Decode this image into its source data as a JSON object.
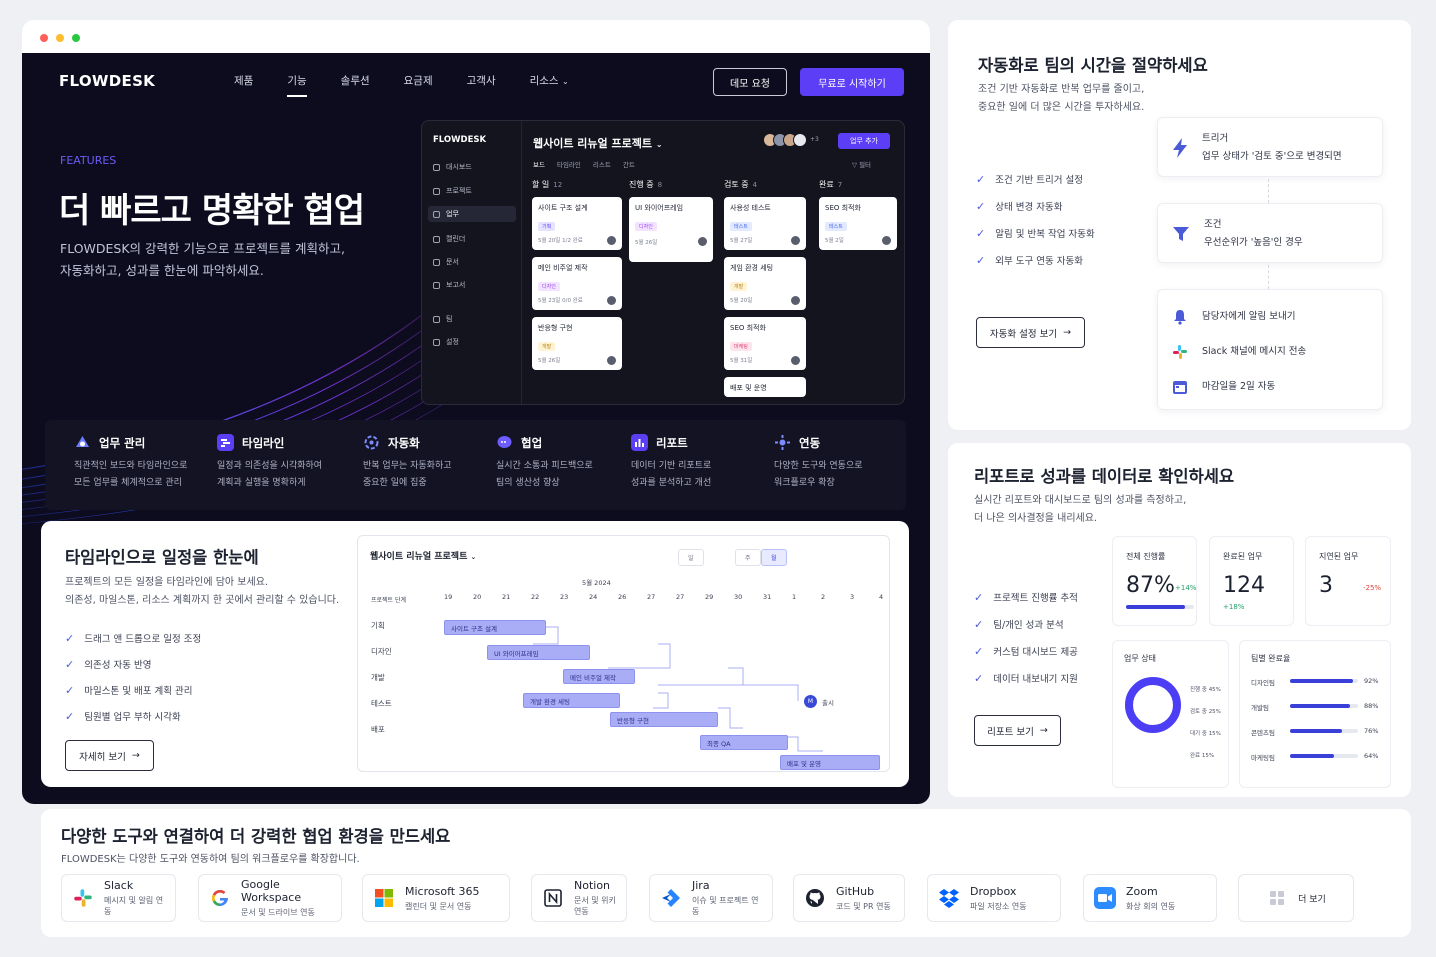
{
  "nav": {
    "logo": "FLOWDESK",
    "links": [
      "제품",
      "기능",
      "솔루션",
      "요금제",
      "고객사",
      "리소스"
    ],
    "demo": "데모 요청",
    "start": "무료로 시작하기"
  },
  "hero": {
    "eyebrow": "FEATURES",
    "title": "더 빠르고 명확한 협업",
    "subtitle_1": "FLOWDESK의 강력한 기능으로 프로젝트를 계획하고,",
    "subtitle_2": "자동화하고, 성과를 한눈에 파악하세요."
  },
  "app": {
    "logo": "FLOWDESK",
    "sidebar": [
      "대시보드",
      "프로젝트",
      "업무",
      "캘린더",
      "문서",
      "보고서",
      "팀",
      "설정"
    ],
    "project": "웹사이트 리뉴얼 프로젝트",
    "tabs": [
      "보드",
      "타임라인",
      "리스트",
      "간트"
    ],
    "members_more": "+3",
    "add": "업무 추가",
    "filter": "필터",
    "columns": [
      {
        "name": "할 일",
        "count": "12",
        "cards": [
          {
            "title": "사이트 구조 설계",
            "tag": "기획",
            "date": "5월 20일  1/2 완료"
          },
          {
            "title": "메인 비주얼 제작",
            "tag": "디자인",
            "date": "5월 23일  0/0 완료"
          },
          {
            "title": "반응형 구현",
            "tag": "개발",
            "date": "5월 26일"
          }
        ]
      },
      {
        "name": "진행 중",
        "count": "8",
        "cards": [
          {
            "title": "UI 와이어프레임",
            "tag": "디자인",
            "date": "5월 26일"
          }
        ]
      },
      {
        "name": "검토 중",
        "count": "4",
        "cards": [
          {
            "title": "사용성 테스트",
            "tag": "테스트",
            "date": "5월 27일"
          },
          {
            "title": "게임 환경 세팅",
            "tag": "개발",
            "date": "5월 20일"
          },
          {
            "title": "SEO 최적화",
            "tag": "마케팅",
            "date": "5월 31일"
          },
          {
            "title": "배포 및 운영",
            "tag": "",
            "date": ""
          }
        ]
      },
      {
        "name": "완료",
        "count": "7",
        "cards": [
          {
            "title": "SEO 최적화",
            "tag": "테스트",
            "date": "5월 2일"
          }
        ]
      }
    ]
  },
  "features": [
    {
      "title": "업무 관리",
      "l1": "직관적인 보드와 타임라인으로",
      "l2": "모든 업무를 체계적으로 관리",
      "icon": "task-icon"
    },
    {
      "title": "타임라인",
      "l1": "일정과 의존성을 시각화하여",
      "l2": "계획과 실행을 명확하게",
      "icon": "timeline-icon"
    },
    {
      "title": "자동화",
      "l1": "반복 업무는 자동화하고",
      "l2": "중요한 일에 집중",
      "icon": "automation-icon"
    },
    {
      "title": "협업",
      "l1": "실시간 소통과 피드백으로",
      "l2": "팀의 생산성 향상",
      "icon": "chat-icon"
    },
    {
      "title": "리포트",
      "l1": "데이터 기반 리포트로",
      "l2": "성과를 분석하고 개선",
      "icon": "report-icon"
    },
    {
      "title": "연동",
      "l1": "다양한 도구와 연동으로",
      "l2": "워크플로우 확장",
      "icon": "integration-icon"
    }
  ],
  "timeline": {
    "title": "타임라인으로 일정을 한눈에",
    "desc_1": "프로젝트의 모든 일정을 타임라인에 담아 보세요.",
    "desc_2": "의존성, 마일스톤, 리소스 계획까지 한 곳에서 관리할 수 있습니다.",
    "checks": [
      "드래그 앤 드롭으로 일정 조정",
      "의존성 자동 반영",
      "마일스톤 및 배포 계획 관리",
      "팀원별 업무 부하 시각화"
    ],
    "button": "자세히 보기",
    "gantt": {
      "title": "웹사이트 리뉴얼 프로젝트",
      "views": [
        "일",
        "주",
        "월"
      ],
      "month": "5월 2024",
      "days": [
        "19",
        "20",
        "21",
        "22",
        "23",
        "24",
        "26",
        "27",
        "27",
        "29",
        "30",
        "31",
        "1",
        "2",
        "3",
        "4"
      ],
      "stage_label": "프로젝트 단계",
      "rows": [
        "기획",
        "디자인",
        "개발",
        "테스트",
        "배포"
      ],
      "bars": [
        "사이트 구조 설계",
        "UI 와이어프레임",
        "메인 비주얼 제작",
        "개발 환경 세팅",
        "반응형 구현",
        "최종 QA",
        "배포 및 운영"
      ],
      "milestone": "M",
      "milestone_label": "출시"
    }
  },
  "automation": {
    "title": "자동화로 팀의 시간을 절약하세요",
    "desc_1": "조건 기반 자동화로 반복 업무를 줄이고,",
    "desc_2": "중요한 일에 더 많은 시간을 투자하세요.",
    "checks": [
      "조건 기반 트리거 설정",
      "상태 변경 자동화",
      "알림 및 반복 작업 자동화",
      "외부 도구 연동 자동화"
    ],
    "button": "자동화 설정 보기",
    "trigger_label": "트리거",
    "trigger_text": "업무 상태가 '검토 중'으로 변경되면",
    "condition_label": "조건",
    "condition_text": "우선순위가 '높음'인 경우",
    "actions": [
      "담당자에게 알림 보내기",
      "Slack 채널에 메시지 전송",
      "마감일을 2일 자동"
    ]
  },
  "reports": {
    "title": "리포트로 성과를 데이터로 확인하세요",
    "desc_1": "실시간 리포트와 대시보드로 팀의 성과를 측정하고,",
    "desc_2": "더 나은 의사결정을 내리세요.",
    "checks": [
      "프로젝트 진행률 추적",
      "팀/개인 성과 분석",
      "커스텀 대시보드 제공",
      "데이터 내보내기 지원"
    ],
    "button": "리포트 보기",
    "kpis": [
      {
        "label": "전체 진행률",
        "value": "87%",
        "delta": "+14%",
        "progress": 0.87
      },
      {
        "label": "완료된 업무",
        "value": "124",
        "delta": "+18%"
      },
      {
        "label": "지연된 업무",
        "value": "3",
        "delta": "-25%"
      }
    ],
    "status_title": "업무 상태",
    "status": [
      {
        "label": "진행 중",
        "pct": "45%"
      },
      {
        "label": "검토 중",
        "pct": "25%"
      },
      {
        "label": "대기 중",
        "pct": "15%"
      },
      {
        "label": "완료",
        "pct": "15%"
      }
    ],
    "team_title": "팀별 완료율",
    "teams": [
      {
        "label": "디자인팀",
        "pct": "92%",
        "value": 0.92
      },
      {
        "label": "개발팀",
        "pct": "88%",
        "value": 0.88
      },
      {
        "label": "콘텐츠팀",
        "pct": "76%",
        "value": 0.76
      },
      {
        "label": "마케팅팀",
        "pct": "64%",
        "value": 0.64
      }
    ]
  },
  "integrations": {
    "title": "다양한 도구와 연결하여 더 강력한 협업 환경을 만드세요",
    "desc": "FLOWDESK는 다양한 도구와 연동하여 팀의 워크플로우를 확장합니다.",
    "tools": [
      {
        "name": "Slack",
        "desc": "메시지 및 알림 연동"
      },
      {
        "name": "Google Workspace",
        "desc": "문서 및 드라이브 연동"
      },
      {
        "name": "Microsoft 365",
        "desc": "캘린더 및 문서 연동"
      },
      {
        "name": "Notion",
        "desc": "문서 및 위키 연동"
      },
      {
        "name": "Jira",
        "desc": "이슈 및 프로젝트 연동"
      },
      {
        "name": "GitHub",
        "desc": "코드 및 PR 연동"
      },
      {
        "name": "Dropbox",
        "desc": "파일 저장소 연동"
      },
      {
        "name": "Zoom",
        "desc": "화상 회의 연동"
      }
    ],
    "more": "더 보기"
  },
  "colors": {
    "accent": "#5b3ef5",
    "hero_bg": "#0c0c1e",
    "check": "#4b5bd8"
  }
}
